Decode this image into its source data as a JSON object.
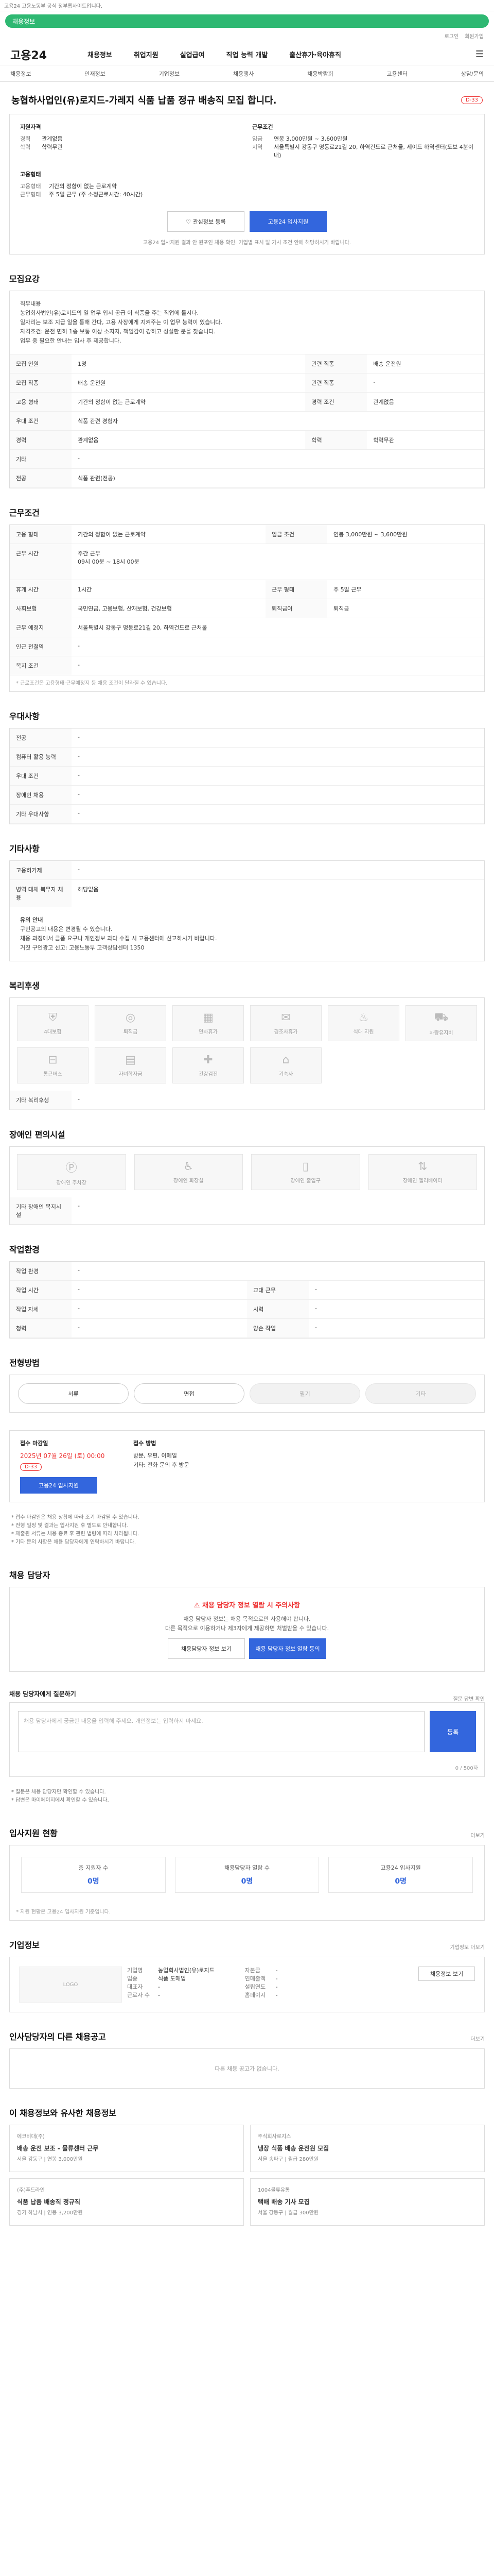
{
  "top": {
    "notice": "고용24 고용노동부 공식 정부웹사이트입니다.",
    "banner": "채용정보",
    "util": [
      "로그인",
      "회원가입"
    ]
  },
  "header": {
    "logo": "고용24",
    "gnb": [
      "채용정보",
      "취업지원",
      "실업급여",
      "직업 능력 개발",
      "출산휴가·육아휴직"
    ]
  },
  "subnav": [
    "채용정보",
    "인재정보",
    "기업정보",
    "채용행사",
    "채용박람회",
    "고용센터",
    "상담/문의"
  ],
  "job": {
    "title": "농협하사업인(유)로지드-가레지 식품 납품 정규 배송직 모집 합니다.",
    "dday": "D-33",
    "left_heading": "지원자격",
    "left": [
      {
        "k": "경력",
        "v": "관계없음"
      },
      {
        "k": "학력",
        "v": "학력무관"
      }
    ],
    "right_heading": "근무조건",
    "right": [
      {
        "k": "임금",
        "v": "연봉 3,000만원 ~ 3,600만원"
      },
      {
        "k": "지역",
        "v": "서울특별시 강동구 명동로21길 20, 하역건드로 근처물, 세이드 하역센터(도보 4분이내)"
      }
    ],
    "type_heading": "고용형태",
    "type": [
      {
        "k": "고용형태",
        "v": "기간의 정함이 없는 근로계약"
      },
      {
        "k": "근무형태",
        "v": "주 5일 근무 (주 소정근로시간: 40시간)"
      }
    ],
    "btn_scrap": "관심정보 등록",
    "btn_apply": "고용24 입사지원",
    "note": "고용24 입사지원 결과 안 원포인 채용 확인: 기업별 표시 발 가시 조건 안에 해당하시기 바랍니다."
  },
  "duty": {
    "section": "모집요강",
    "text": "직무내용\n농업회사법인(유)로지드의 일 업무 입시 공급 이 식품을 주는 직업에 돌시다.\n일자리는 보조 지급 일을 통해 간다, 고용 사장에게 지켜주는 이 업무 능력이 있습니다.\n자격조건: 운전 면허 1종 보통 이상 소지자, 책임감이 강하고 성실한 분을 찾습니다.\n업무 중 필요한 안내는 입사 후 제공합니다.",
    "rows": [
      {
        "k": "모집 인원",
        "v": "1명",
        "k2": "관련 직종",
        "v2": "배송 운전원"
      },
      {
        "k": "모집 직종",
        "v": "배송 운전원",
        "k2": "관련 직종",
        "v2": "-"
      },
      {
        "k": "고용 형태",
        "v": "기간의 정함이 없는 근로계약",
        "k2": "경력 조건",
        "v2": "관계없음"
      },
      {
        "k": "우대 조건",
        "v": "식품 관련 경험자",
        "k2": "",
        "v2": ""
      },
      {
        "k": "경력",
        "v": "관계없음",
        "k2": "학력",
        "v2": "학력무관"
      },
      {
        "k": "기타",
        "v": "-",
        "k2": "",
        "v2": ""
      },
      {
        "k": "전공",
        "v": "식품 관련(전공)",
        "k2": "",
        "v2": ""
      }
    ]
  },
  "cond": {
    "section": "근무조건",
    "rows": [
      {
        "k": "고용 형태",
        "v": "기간의 정함이 없는 근로계약",
        "k2": "임금 조건",
        "v2": "연봉 3,000만원 ~ 3,600만원"
      },
      {
        "k": "근무 시간",
        "v": "주간 근무\n09시 00분 ~ 18시 00분",
        "k2": "",
        "v2": ""
      },
      {
        "k": "휴게 시간",
        "v": "1시간",
        "k2": "근무 형태",
        "v2": "주 5일 근무"
      },
      {
        "k": "사회보험",
        "v": "국민연금, 고용보험, 산재보험, 건강보험",
        "k2": "퇴직급여",
        "v2": "퇴직금"
      },
      {
        "k": "근무 예정지",
        "v": "서울특별시 강동구 명동로21길 20, 하역건드로 근처물",
        "k2": "",
        "v2": ""
      },
      {
        "k": "인근 전철역",
        "v": "-",
        "k2": "",
        "v2": ""
      },
      {
        "k": "복지 조건",
        "v": "-",
        "k2": "",
        "v2": ""
      }
    ],
    "note": "* 근로조건은 고용형태·근무예정지 등 채용 조건이 달라질 수 있습니다."
  },
  "pref": {
    "section": "우대사항",
    "rows": [
      {
        "k": "전공",
        "v": "-"
      },
      {
        "k": "컴퓨터 활용 능력",
        "v": "-"
      },
      {
        "k": "우대 조건",
        "v": "-"
      },
      {
        "k": "장애인 채용",
        "v": "-"
      },
      {
        "k": "기타 우대사항",
        "v": "-"
      }
    ]
  },
  "etc": {
    "section": "기타사항",
    "rows": [
      {
        "k": "고용허가제",
        "v": "-"
      },
      {
        "k": "병역 대체 복무자 채용",
        "v": "해당없음"
      }
    ],
    "warn_title": "유의 안내",
    "warn": "구인공고의 내용은 변경될 수 있습니다.\n채용 과정에서 금품 요구나 개인정보 과다 수집 시 고용센터에 신고하시기 바랍니다.\n거짓 구인광고 신고: 고용노동부 고객상담센터 1350"
  },
  "welfare": {
    "section": "복리후생",
    "items": [
      "4대보험",
      "퇴직금",
      "연차휴가",
      "경조사휴가",
      "식대 지원",
      "차량유지비",
      "통근버스",
      "자녀학자금",
      "건강검진",
      "기숙사"
    ],
    "note_k": "기타 복리후생",
    "note_v": "-"
  },
  "disab": {
    "section": "장애인 편의시설",
    "items": [
      "장애인 주차장",
      "장애인 화장실",
      "장애인 출입구",
      "장애인 엘리베이터"
    ],
    "note_k": "기타 장애인 복지시설",
    "note_v": "-"
  },
  "work": {
    "section": "작업환경",
    "rows": [
      {
        "k": "작업 환경",
        "v": "-",
        "k2": "",
        "v2": ""
      },
      {
        "k": "작업 시간",
        "v": "-",
        "k2": "교대 근무",
        "v2": "-"
      },
      {
        "k": "작업 자세",
        "v": "-",
        "k2": "시력",
        "v2": "-"
      },
      {
        "k": "청력",
        "v": "-",
        "k2": "양손 작업",
        "v2": "-"
      }
    ]
  },
  "process": {
    "section": "전형방법",
    "steps": [
      "서류",
      "면접",
      "필기",
      "기타"
    ]
  },
  "apply": {
    "k1": "접수 마감일",
    "deadline": "2025년 07월 26일 (토) 00:00",
    "dday": "D-33",
    "k2": "접수 방법",
    "methods": "방문, 우편, 이메일\n기타: 전화 문의 후 방문",
    "btn": "고용24 입사지원",
    "bullets": "* 접수 마감일은 채용 상황에 따라 조기 마감될 수 있습니다.\n* 전형 일정 및 결과는 입사지원 후 별도로 안내합니다.\n* 제출된 서류는 채용 종료 후 관련 법령에 따라 처리됩니다.\n* 기타 문의 사항은 채용 담당자에게 연락하시기 바랍니다."
  },
  "contact": {
    "section": "채용 담당자",
    "warn": "채용 담당자 정보 열람 시 주의사항",
    "desc": "채용 담당자 정보는 채용 목적으로만 사용해야 합니다.\n다른 목적으로 이용하거나 제3자에게 제공하면 처벌받을 수 있습니다.",
    "b1": "채용담당자 정보 보기",
    "b2": "채용 담당자 정보 열람 동의"
  },
  "qna": {
    "section": "채용 담당자에게 질문하기",
    "help": "질문 답변 확인",
    "placeholder": "채용 담당자에게 궁금한 내용을 입력해 주세요. 개인정보는 입력하지 마세요.",
    "count": "0 / 500자",
    "btn": "등록",
    "bullets": "* 질문은 채용 담당자만 확인할 수 있습니다.\n* 답변은 마이페이지에서 확인할 수 있습니다."
  },
  "stats": {
    "section": "입사지원 현황",
    "more": "더보기",
    "items": [
      {
        "k": "총 지원자 수",
        "v": "0명"
      },
      {
        "k": "채용담당자 열람 수",
        "v": "0명"
      },
      {
        "k": "고용24 입사지원",
        "v": "0명"
      }
    ],
    "note": "* 지원 현황은 고용24 입사지원 기준입니다."
  },
  "company": {
    "section": "기업정보",
    "more": "기업정보 더보기",
    "logo": "LOGO",
    "rows": [
      {
        "k": "기업명",
        "v": "농업회사법인(유)로지드"
      },
      {
        "k": "업종",
        "v": "식품 도매업"
      },
      {
        "k": "대표자",
        "v": "-"
      },
      {
        "k": "근로자 수",
        "v": "-"
      },
      {
        "k": "자본금",
        "v": "-"
      },
      {
        "k": "연매출액",
        "v": "-"
      },
      {
        "k": "설립연도",
        "v": "-"
      },
      {
        "k": "홈페이지",
        "v": "-"
      }
    ],
    "btn": "채용정보 보기"
  },
  "other": {
    "section": "인사담당자의 다른 채용공고",
    "more": "더보기",
    "empty": "다른 채용 공고가 없습니다."
  },
  "recs": {
    "section": "이 채용정보와 유사한 채용정보",
    "cards": [
      {
        "co": "에코비대(주)",
        "t": "배송 운전 보조 - 물류센터 근무",
        "m": "서울 강동구 | 연봉 3,000만원"
      },
      {
        "co": "주식회사로지스",
        "t": "냉장 식품 배송 운전원 모집",
        "m": "서울 송파구 | 월급 280만원"
      },
      {
        "co": "(주)푸드라인",
        "t": "식품 납품 배송직 정규직",
        "m": "경기 하남시 | 연봉 3,200만원"
      },
      {
        "co": "1004물류유통",
        "t": "택배 배송 기사 모집",
        "m": "서울 강동구 | 월급 300만원"
      }
    ]
  }
}
